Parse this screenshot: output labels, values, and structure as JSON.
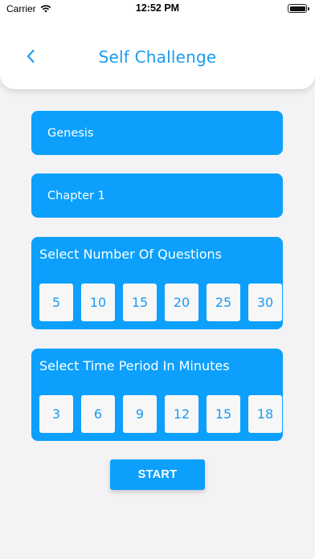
{
  "status_bar": {
    "carrier": "Carrier",
    "time": "12:52 PM"
  },
  "header": {
    "title": "Self Challenge",
    "back_icon": "chevron-left-icon"
  },
  "book_field": {
    "value": "Genesis"
  },
  "chapter_field": {
    "value": "Chapter 1"
  },
  "questions_card": {
    "title": "Select Number Of Questions",
    "options": [
      "5",
      "10",
      "15",
      "20",
      "25",
      "30"
    ]
  },
  "time_card": {
    "title": "Select Time Period In Minutes",
    "options": [
      "3",
      "6",
      "9",
      "12",
      "15",
      "18"
    ]
  },
  "start_button": {
    "label": "START"
  },
  "colors": {
    "accent": "#0ca0fc",
    "title_blue": "#1a9bf0",
    "background": "#f3f3f5"
  }
}
